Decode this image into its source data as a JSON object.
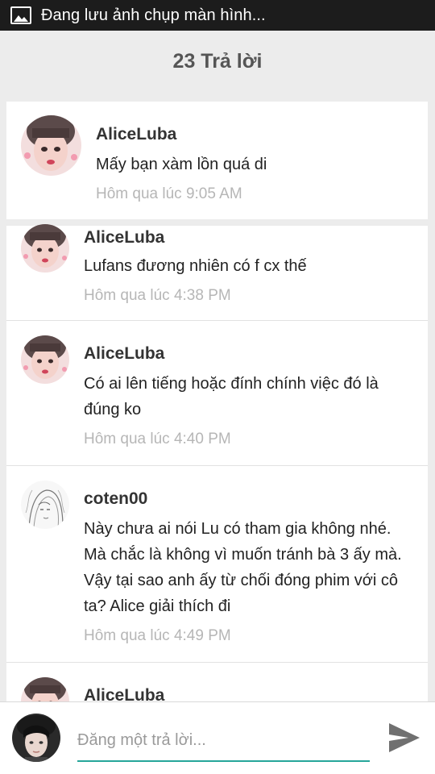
{
  "status_bar": {
    "icon": "image-icon",
    "text": "Đang lưu ảnh chụp màn hình..."
  },
  "header": {
    "title": "23 Trả lời"
  },
  "replies": [
    {
      "author": "AliceLuba",
      "text": "Mấy bạn xàm lồn quá di",
      "time": "Hôm qua lúc 9:05 AM",
      "avatar": "girl-avatar-photo"
    },
    {
      "author": "AliceLuba",
      "text": "Lufans đương nhiên có f cx thế",
      "time": "Hôm qua lúc 4:38 PM",
      "avatar": "girl-avatar-photo"
    },
    {
      "author": "AliceLuba",
      "text": "Có ai lên tiếng hoặc đính chính việc đó là đúng ko",
      "time": "Hôm qua lúc 4:40 PM",
      "avatar": "girl-avatar-photo"
    },
    {
      "author": "coten00",
      "text": "Này chưa ai nói Lu có tham gia không nhé. Mà chắc là không vì muốn tránh bà 3 ấy mà. Vậy tại sao anh ấy từ chối đóng phim với cô ta?  Alice giải thích đi",
      "time": "Hôm qua lúc 4:49 PM",
      "avatar": "sketch-avatar"
    },
    {
      "author": "AliceLuba",
      "text": "",
      "time": "",
      "avatar": "girl-avatar-photo"
    }
  ],
  "composer": {
    "placeholder": "Đăng một trả lời...",
    "value": "",
    "send_icon": "send-icon",
    "avatar": "user-avatar-photo"
  },
  "colors": {
    "status_bar": "#1c1c1c",
    "background": "#ececec",
    "accent": "#26a69a",
    "timestamp": "#b6b6b6"
  }
}
